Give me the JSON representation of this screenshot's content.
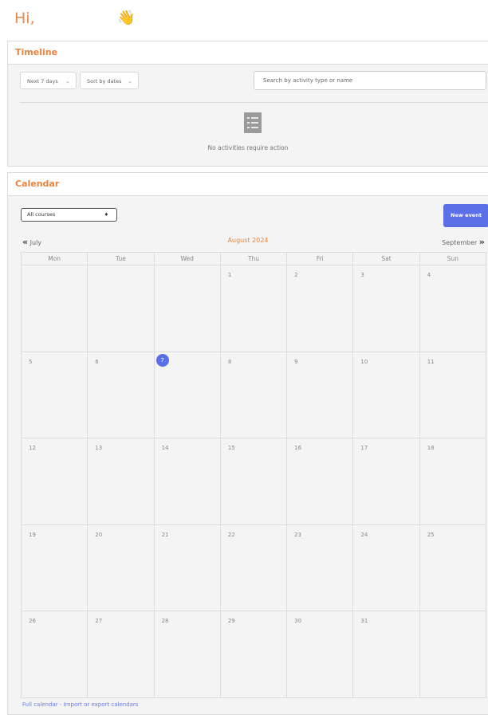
{
  "greeting": {
    "text": "Hi,",
    "emoji": "👋"
  },
  "timeline": {
    "title": "Timeline",
    "filter_days": "Next 7 days",
    "sort": "Sort by dates",
    "search_placeholder": "Search by activity type or name",
    "empty_message": "No activities require action"
  },
  "calendar": {
    "title": "Calendar",
    "course_filter": "All courses",
    "new_event_label": "New event",
    "prev_month": "July",
    "current_month": "August 2024",
    "next_month": "September",
    "weekdays": [
      "Mon",
      "Tue",
      "Wed",
      "Thu",
      "Fri",
      "Sat",
      "Sun"
    ],
    "today": "7",
    "weeks": [
      [
        "",
        "",
        "",
        "1",
        "2",
        "3",
        "4"
      ],
      [
        "5",
        "6",
        "7",
        "8",
        "9",
        "10",
        "11"
      ],
      [
        "12",
        "13",
        "14",
        "15",
        "16",
        "17",
        "18"
      ],
      [
        "19",
        "20",
        "21",
        "22",
        "23",
        "24",
        "25"
      ],
      [
        "26",
        "27",
        "28",
        "29",
        "30",
        "31",
        ""
      ]
    ],
    "footer_full": "Full calendar",
    "footer_sep": " - ",
    "footer_import": "Import or export calendars"
  },
  "colors": {
    "accent": "#e8843f",
    "primary": "#5b6fe6",
    "panel_bg": "#f4f4f4"
  }
}
